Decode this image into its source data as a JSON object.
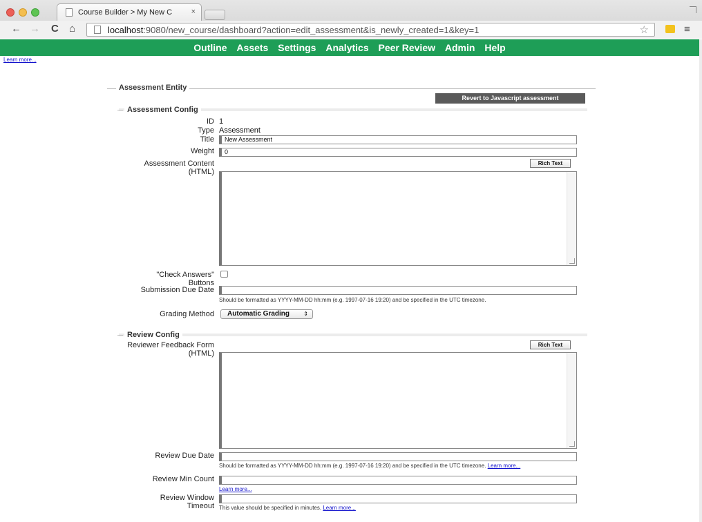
{
  "browser": {
    "tab_title": "Course Builder > My New C",
    "tab_close": "×",
    "url_host": "localhost",
    "url_rest": ":9080/new_course/dashboard?action=edit_assessment&is_newly_created=1&key=1",
    "icons": [
      "back-arrow-icon",
      "forward-arrow-icon",
      "reload-icon",
      "home-icon",
      "page-icon",
      "star-icon",
      "extension-icon",
      "menu-icon"
    ]
  },
  "nav": {
    "items": [
      {
        "label": "Outline"
      },
      {
        "label": "Assets"
      },
      {
        "label": "Settings"
      },
      {
        "label": "Analytics"
      },
      {
        "label": "Peer Review"
      },
      {
        "label": "Admin"
      },
      {
        "label": "Help"
      }
    ],
    "color": "#1e9e57"
  },
  "top_link": "Learn more...",
  "form": {
    "legend": "Assessment Entity",
    "revert_button": "Revert to Javascript assessment",
    "assessment_config": {
      "legend": "Assessment Config",
      "id_label": "ID",
      "id_value": "1",
      "type_label": "Type",
      "type_value": "Assessment",
      "title_label": "Title",
      "title_value": "New Assessment",
      "weight_label": "Weight",
      "weight_value": "0",
      "content_label": "Assessment Content (HTML)",
      "rich_text_button": "Rich Text",
      "check_answers_label": "\"Check Answers\" Buttons",
      "due_date_label": "Submission Due Date",
      "due_date_hint": "Should be formatted as YYYY-MM-DD hh:mm (e.g. 1997-07-16 19:20) and be specified in the UTC timezone.",
      "grading_label": "Grading Method",
      "grading_value": "Automatic Grading"
    },
    "review_config": {
      "legend": "Review Config",
      "feedback_label": "Reviewer Feedback Form (HTML)",
      "rich_text_button": "Rich Text",
      "review_due_label": "Review Due Date",
      "review_due_hint": "Should be formatted as YYYY-MM-DD hh:mm (e.g. 1997-07-16 19:20) and be specified in the UTC timezone.",
      "review_due_link": "Learn more...",
      "min_count_label": "Review Min Count",
      "min_count_link": "Learn more...",
      "timeout_label": "Review Window Timeout",
      "timeout_hint": "This value should be specified in minutes.",
      "timeout_link": "Learn more..."
    }
  }
}
